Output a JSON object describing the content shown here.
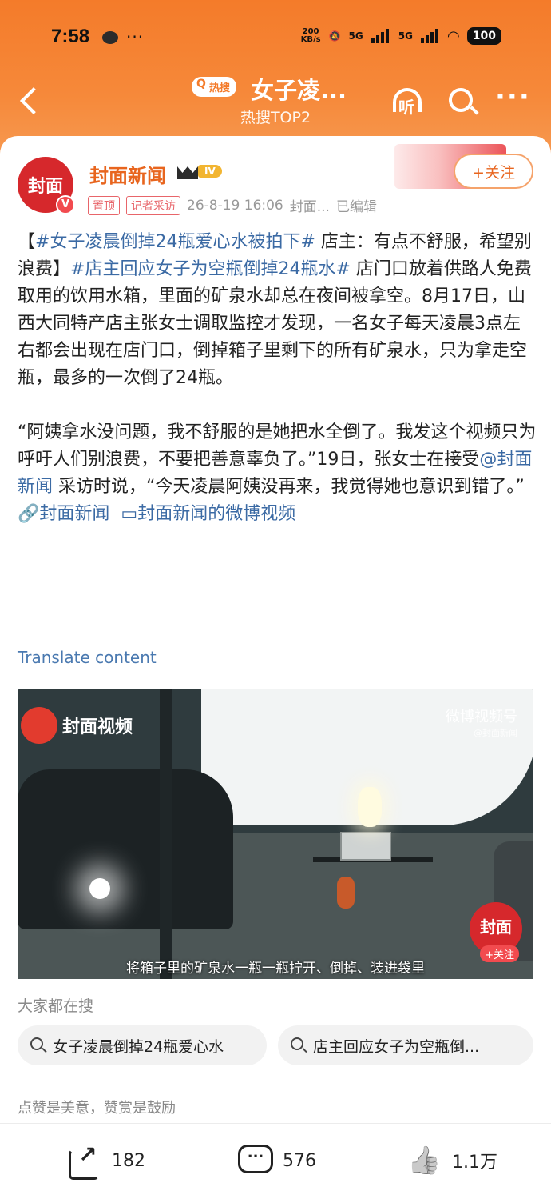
{
  "status_bar": {
    "time": "7:58",
    "network_speed_top": "200",
    "network_speed_unit": "KB/s",
    "sim1": "5G",
    "sim2": "5G",
    "battery": "100"
  },
  "nav": {
    "hot_badge": "热搜",
    "title": "女子凌...",
    "subtitle": "热搜TOP2",
    "listen_label": "听"
  },
  "post": {
    "author": "封面新闻",
    "level": "IV",
    "follow_label": "+关注",
    "tag_pinned": "置顶",
    "tag_reporter": "记者采访",
    "timestamp": "26-8-19 16:06",
    "source": "封面...",
    "edited": "已编辑",
    "avatar_text": "封面",
    "para1_prefix": "【",
    "hashtag1": "#女子凌晨倒掉24瓶爱心水被拍下#",
    "para1_mid": " 店主：有点不舒服，希望别浪费】",
    "hashtag2": "#店主回应女子为空瓶倒掉24瓶水#",
    "para1_rest": " 店门口放着供路人免费取用的饮用水箱，里面的矿泉水却总在夜间被拿空。8月17日，山西大同特产店主张女士调取监控才发现，一名女子每天凌晨3点左右都会出现在店门口，倒掉箱子里剩下的所有矿泉水，只为拿走空瓶，最多的一次倒了24瓶。",
    "para2_a": "“阿姨拿水没问题，我不舒服的是她把水全倒了。我发这个视频只为呼吁人们别浪费，不要把善意辜负了。”19日，张女士在接受",
    "mention": "@封面新闻",
    "para2_b": " 采访时说，“今天凌晨阿姨没再来，我觉得她也意识到错了。”",
    "link1": "🔗封面新闻",
    "link2": "▭封面新闻的微博视频",
    "translate": "Translate content"
  },
  "video": {
    "logo_text": "封面视频",
    "watermark": "微博视频号",
    "watermark_sub": "@封面新闻",
    "subtitle": "将箱子里的矿泉水一瓶一瓶拧开、倒掉、装进袋里",
    "badge_text": "封面",
    "badge_follow": "+关注"
  },
  "related": {
    "label": "大家都在搜",
    "items": [
      "女子凌晨倒掉24瓶爱心水",
      "店主回应女子为空瓶倒..."
    ]
  },
  "praise_text": "点赞是美意，赞赏是鼓励",
  "actions": {
    "reposts": "182",
    "comments": "576",
    "likes": "1.1万"
  }
}
